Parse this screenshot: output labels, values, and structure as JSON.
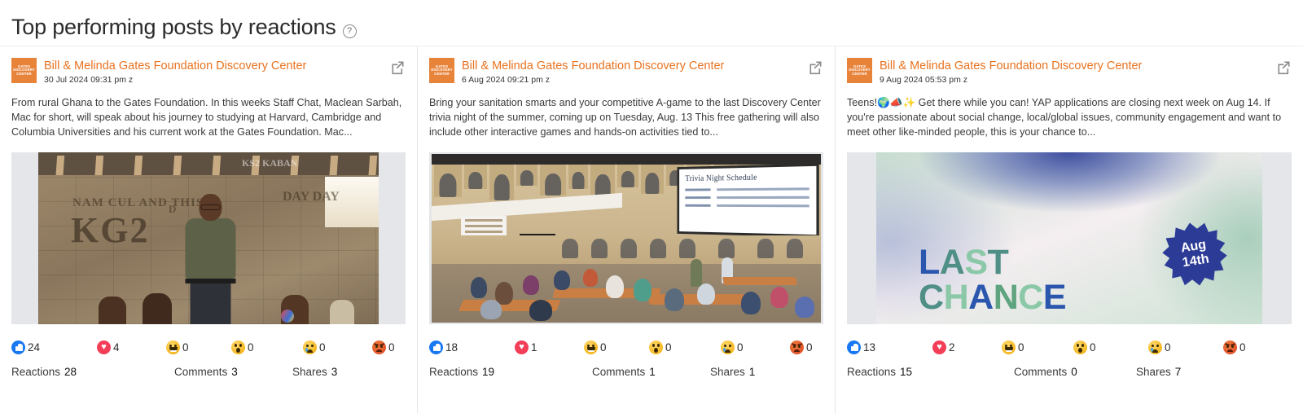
{
  "header": {
    "title": "Top performing posts by reactions",
    "help_icon": "help-circle-icon",
    "help_glyph": "?"
  },
  "avatar": {
    "line1": "GATES",
    "line2": "DISCOVERY",
    "line3": "CENTER",
    "bg_color": "#e8833a"
  },
  "colors": {
    "page_name": "#e8721f",
    "like": "#1877f2",
    "love": "#f33e58",
    "face": "#f5b71e",
    "angry": "#e0542a",
    "card_divider": "#e6e6e6"
  },
  "labels": {
    "reactions": "Reactions",
    "comments": "Comments",
    "shares": "Shares",
    "external_link_icon": "external-link-icon"
  },
  "reaction_types": [
    "like",
    "love",
    "haha",
    "wow",
    "sad",
    "angry"
  ],
  "posts": [
    {
      "page_name": "Bill & Melinda Gates Foundation Discovery Center",
      "date": "30 Jul 2024 09:31 pm z",
      "text": "From rural Ghana to the Gates Foundation. In this weeks Staff Chat, Maclean Sarbah, Mac for short, will speak about his journey to studying at Harvard, Cambridge and Columbia Universities and his current work at the Gates Foundation. Mac...",
      "image_alt": "Man standing in a rural Ghana classroom with children",
      "reactions": {
        "like": "24",
        "love": "4",
        "haha": "0",
        "wow": "0",
        "sad": "0",
        "angry": "0"
      },
      "totals": {
        "reactions": "28",
        "comments": "3",
        "shares": "3"
      }
    },
    {
      "page_name": "Bill & Melinda Gates Foundation Discovery Center",
      "date": "6 Aug 2024 09:21 pm z",
      "text": "Bring your sanitation smarts and your competitive A-game to the last Discovery Center trivia night of the summer, coming up on Tuesday, Aug. 13 This free gathering will also include other interactive games and hands-on activities tied to...",
      "image_alt": "Audience seated at tables in the Discovery Center hall during trivia night",
      "image_screen_title": "Trivia Night Schedule",
      "reactions": {
        "like": "18",
        "love": "1",
        "haha": "0",
        "wow": "0",
        "sad": "0",
        "angry": "0"
      },
      "totals": {
        "reactions": "19",
        "comments": "1",
        "shares": "1"
      }
    },
    {
      "page_name": "Bill & Melinda Gates Foundation Discovery Center",
      "date": "9 Aug 2024 05:53 pm z",
      "text": "Teens!🌍📣✨ Get there while you can! YAP applications are closing next week on Aug 14. If you're passionate about social change, local/global issues, community engagement and want to meet other like-minded people, this is your chance to...",
      "image_alt": "Graphic reading LAST CHANCE with an Aug 14th starburst badge",
      "graphic": {
        "line1": "LAST",
        "line2": "CHANCE",
        "badge_line1": "Aug",
        "badge_line2": "14th"
      },
      "reactions": {
        "like": "13",
        "love": "2",
        "haha": "0",
        "wow": "0",
        "sad": "0",
        "angry": "0"
      },
      "totals": {
        "reactions": "15",
        "comments": "0",
        "shares": "7"
      }
    }
  ]
}
